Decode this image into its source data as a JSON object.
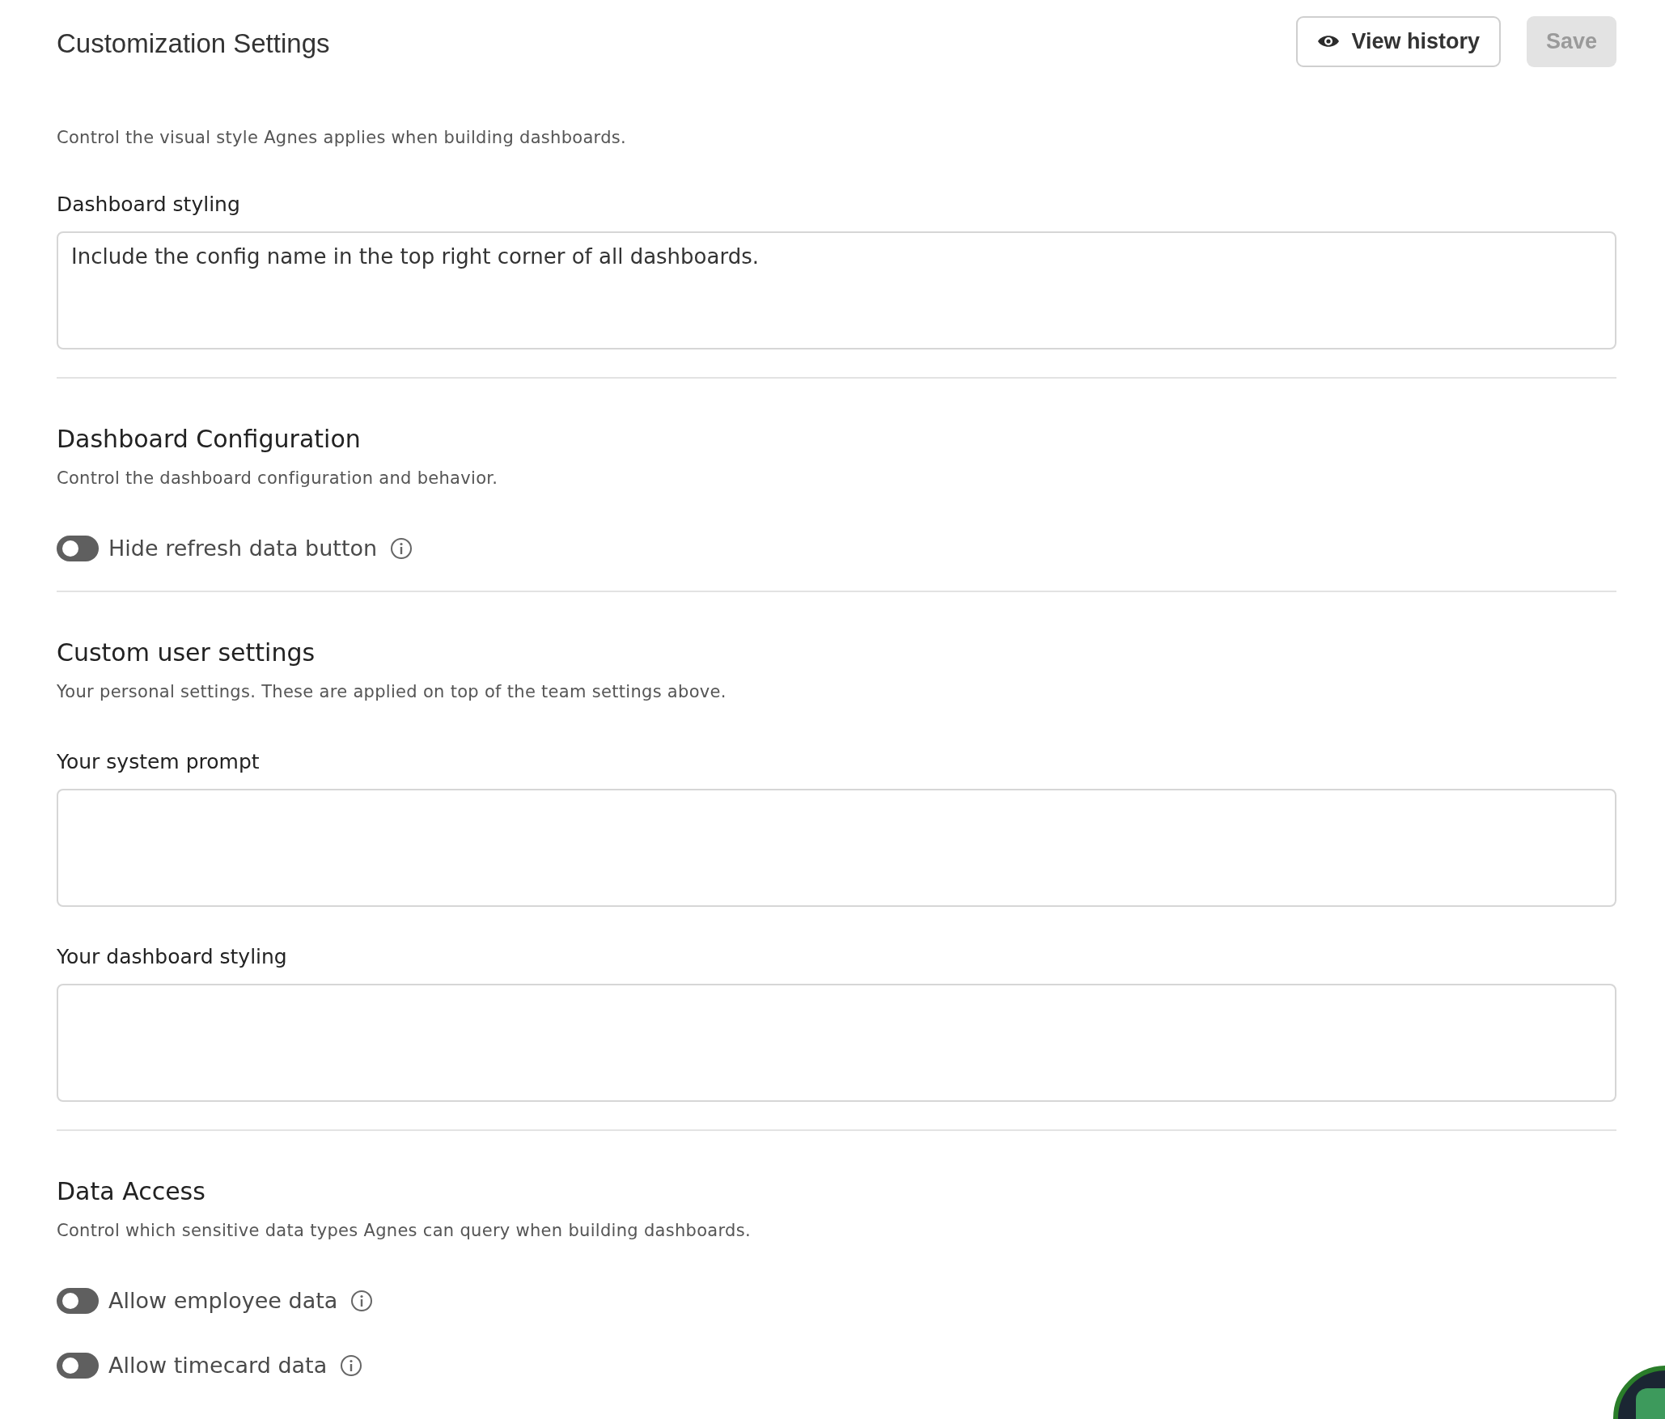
{
  "header": {
    "title": "Customization Settings",
    "buttons": [
      {
        "label": "View history",
        "kind": "outline",
        "disabled": false
      },
      {
        "label": "Save",
        "kind": "filled",
        "disabled": true
      }
    ]
  },
  "sections": [
    {
      "description": "Control the visual style Agnes applies when building dashboards.",
      "fields": [
        {
          "kind": "textarea",
          "label": "Dashboard styling",
          "value": "Include the config name in the top right corner of all dashboards."
        }
      ]
    },
    {
      "title": "Dashboard Configuration",
      "description": "Control the dashboard configuration and behavior.",
      "fields": [
        {
          "kind": "toggle",
          "label": "Hide refresh data button",
          "on": false
        }
      ]
    },
    {
      "title": "Custom user settings",
      "description": "Your personal settings. These are applied on top of the team settings above.",
      "fields": [
        {
          "kind": "textarea",
          "label": "Your system prompt"
        },
        {
          "kind": "textarea",
          "label": "Your dashboard styling"
        }
      ]
    },
    {
      "title": "Data Access",
      "description": "Control which sensitive data types Agnes can query when building dashboards.",
      "fields": [
        {
          "kind": "toggle",
          "label": "Allow employee data",
          "on": false
        },
        {
          "kind": "toggle",
          "label": "Allow timecard data",
          "on": false
        }
      ]
    }
  ]
}
